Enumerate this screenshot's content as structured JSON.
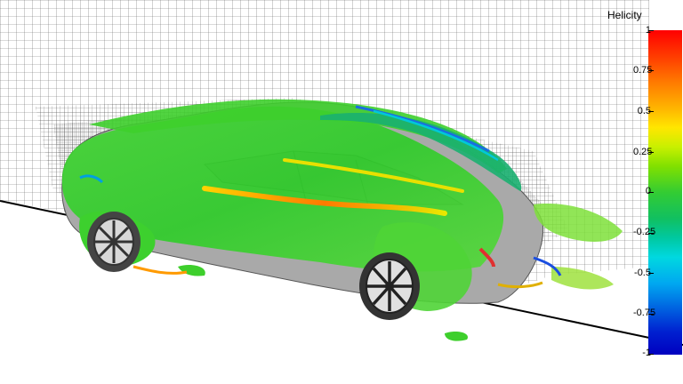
{
  "colorbar": {
    "title": "Helicity",
    "ticks": [
      "1",
      "0.75",
      "0.5",
      "0.25",
      "0",
      "-0.25",
      "-0.5",
      "-0.75",
      "-1"
    ]
  },
  "colors": {
    "body_gray": "#a8a8a8",
    "vortex_green": "#3ccf2a",
    "mesh_line": "#555555"
  }
}
